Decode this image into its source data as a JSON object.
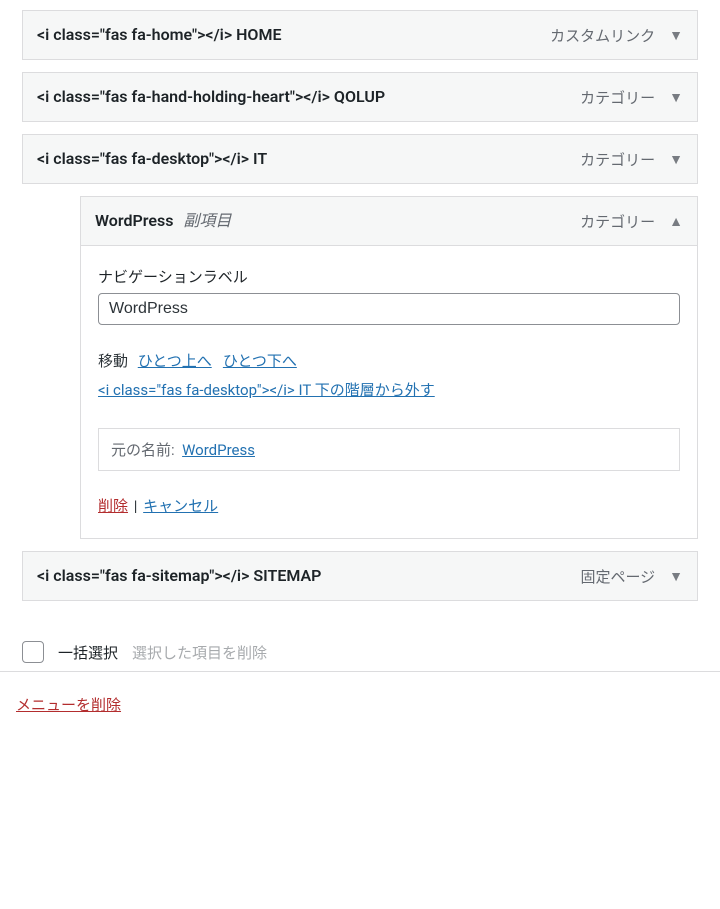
{
  "items": {
    "home": {
      "title": "<i class=\"fas fa-home\"></i> HOME",
      "type": "カスタムリンク"
    },
    "qolup": {
      "title": "<i class=\"fas fa-hand-holding-heart\"></i> QOLUP",
      "type": "カテゴリー"
    },
    "it": {
      "title": "<i class=\"fas fa-desktop\"></i> IT",
      "type": "カテゴリー"
    },
    "wordpress": {
      "title": "WordPress",
      "sub": "副項目",
      "type": "カテゴリー"
    },
    "sitemap": {
      "title": "<i class=\"fas fa-sitemap\"></i> SITEMAP",
      "type": "固定ページ"
    }
  },
  "settings": {
    "nav_label": "ナビゲーションラベル",
    "nav_value": "WordPress",
    "move_label": "移動",
    "move_up": "ひとつ上へ",
    "move_down": "ひとつ下へ",
    "move_out": "<i class=\"fas fa-desktop\"></i> IT 下の階層から外す",
    "original_label": "元の名前:",
    "original_value": "WordPress",
    "delete": "削除",
    "cancel": "キャンセル"
  },
  "bulk": {
    "select_all": "一括選択",
    "delete_selected": "選択した項目を削除"
  },
  "footer": {
    "delete_menu": "メニューを削除"
  }
}
